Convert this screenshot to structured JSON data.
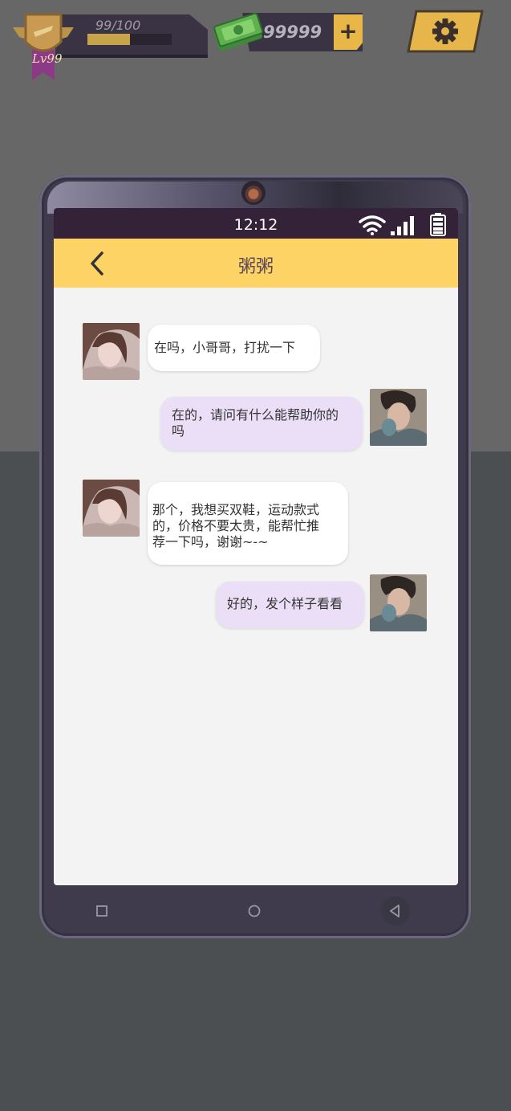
{
  "hud": {
    "xp_text": "99/100",
    "xp_progress": 0.5,
    "level_text": "Lv99",
    "money": "99999",
    "plus_label": "+"
  },
  "phone": {
    "time": "12:12",
    "chat_title": "粥粥",
    "messages": [
      {
        "side": "left",
        "lines": [
          "在吗，小哥哥，打扰一下"
        ]
      },
      {
        "side": "right",
        "lines": [
          "在的，请问有什么能帮助你的",
          "吗"
        ]
      },
      {
        "side": "left",
        "lines": [
          "那个，我想买双鞋，运动款式",
          "的，价格不要太贵，能帮忙推",
          "荐一下吗，谢谢~-~"
        ]
      },
      {
        "side": "right",
        "lines": [
          "好的，发个样子看看"
        ]
      }
    ]
  },
  "colors": {
    "header_bg": "#fdd365",
    "status_bg": "#332238",
    "left_bubble": "#ffffff",
    "right_bubble": "#eadff6",
    "accent_gold": "#e8b748"
  },
  "icons": [
    "badge-icon",
    "cash-icon",
    "plus-icon",
    "gear-icon",
    "wifi-icon",
    "signal-icon",
    "battery-icon",
    "back-arrow-icon",
    "nav-square-icon",
    "nav-circle-icon",
    "nav-triangle-icon"
  ]
}
